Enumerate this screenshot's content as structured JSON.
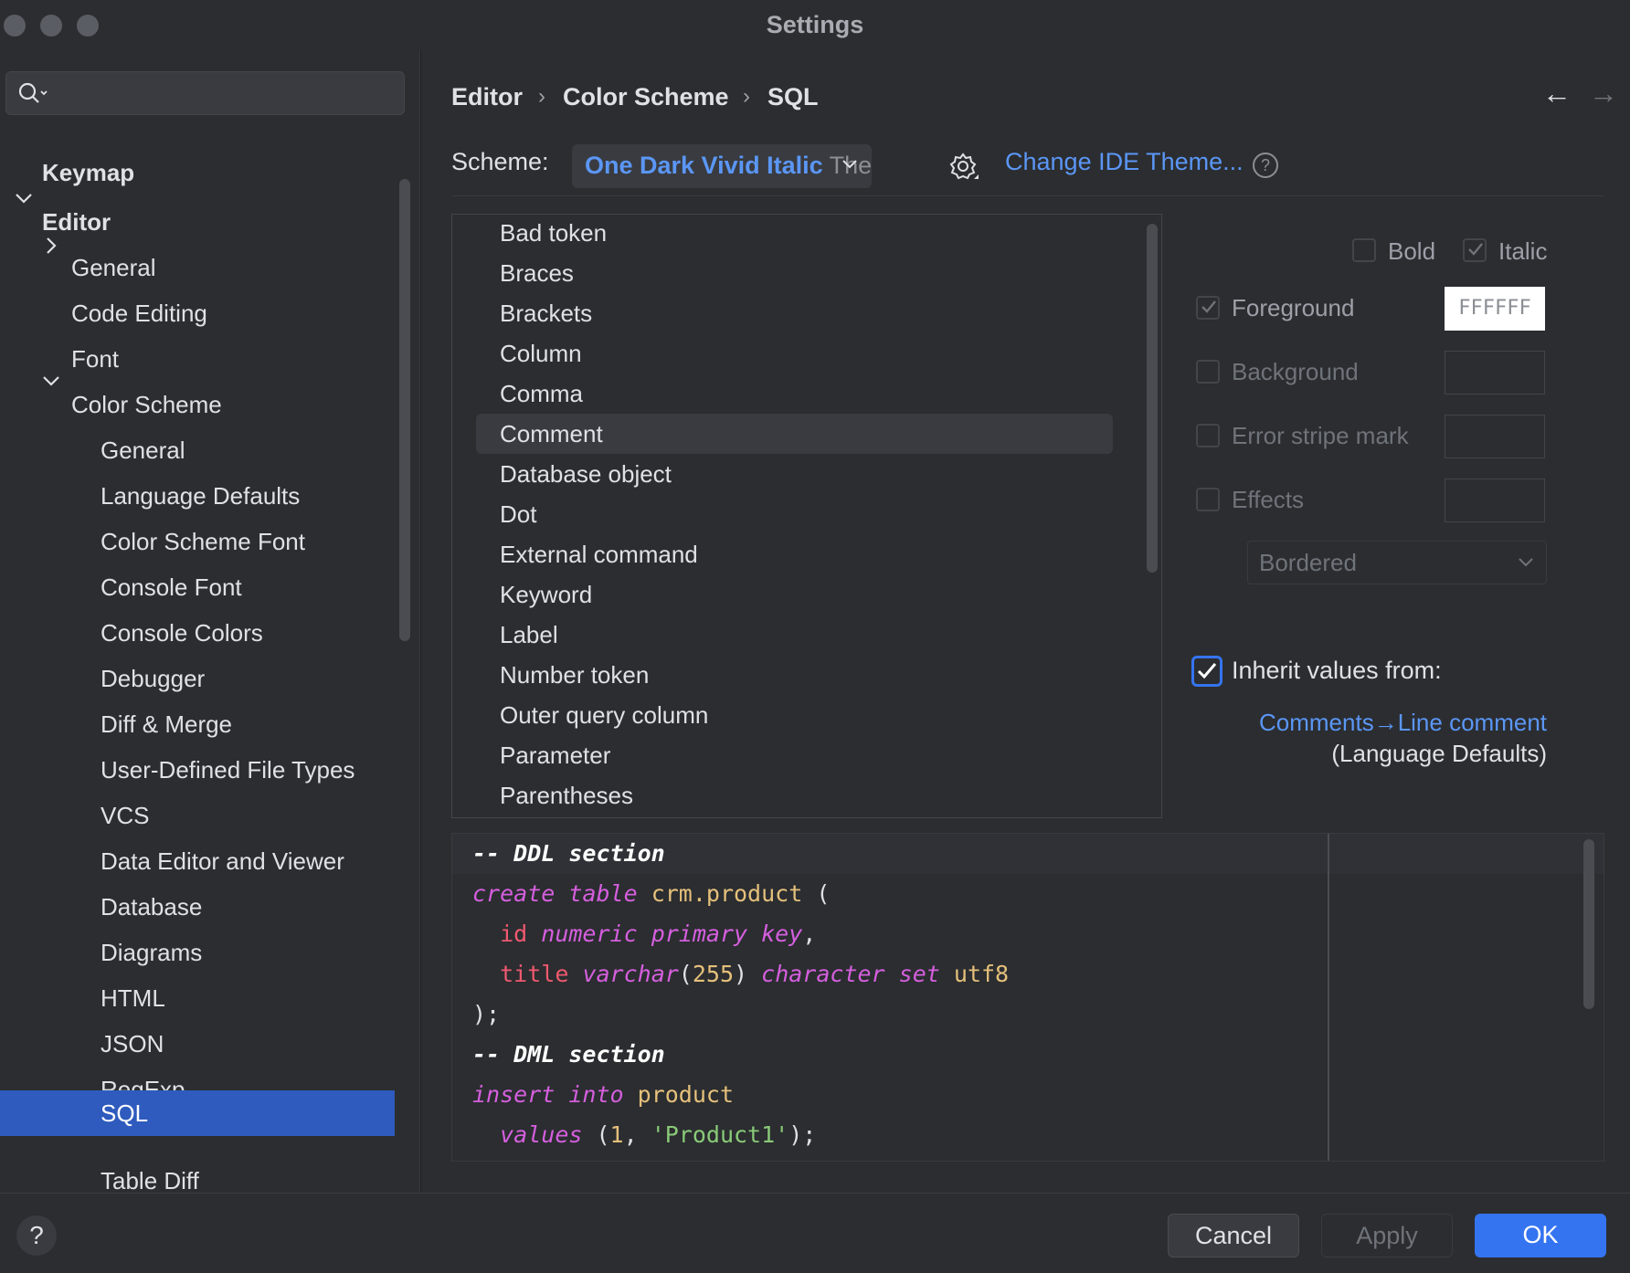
{
  "window": {
    "title": "Settings"
  },
  "sidebar": {
    "search_placeholder": "",
    "items": [
      {
        "label": "Keymap"
      },
      {
        "label": "Editor"
      },
      {
        "label": "General"
      },
      {
        "label": "Code Editing"
      },
      {
        "label": "Font"
      },
      {
        "label": "Color Scheme"
      },
      {
        "label": "General"
      },
      {
        "label": "Language Defaults"
      },
      {
        "label": "Color Scheme Font"
      },
      {
        "label": "Console Font"
      },
      {
        "label": "Console Colors"
      },
      {
        "label": "Debugger"
      },
      {
        "label": "Diff & Merge"
      },
      {
        "label": "User-Defined File Types"
      },
      {
        "label": "VCS"
      },
      {
        "label": "Data Editor and Viewer"
      },
      {
        "label": "Database"
      },
      {
        "label": "Diagrams"
      },
      {
        "label": "HTML"
      },
      {
        "label": "JSON"
      },
      {
        "label": "RegExp"
      },
      {
        "label": "SQL"
      },
      {
        "label": "Table Diff"
      }
    ],
    "selected": "SQL"
  },
  "breadcrumb": [
    "Editor",
    "Color Scheme",
    "SQL"
  ],
  "scheme": {
    "label": "Scheme:",
    "value_bold": "One Dark Vivid Italic",
    "value_suffix": " Them",
    "change_theme_link": "Change IDE Theme...",
    "help_glyph": "?"
  },
  "attributes": {
    "items": [
      "Bad token",
      "Braces",
      "Brackets",
      "Column",
      "Comma",
      "Comment",
      "Database object",
      "Dot",
      "External command",
      "Keyword",
      "Label",
      "Number token",
      "Outer query column",
      "Parameter",
      "Parentheses"
    ],
    "selected": "Comment"
  },
  "options": {
    "bold": {
      "label": "Bold",
      "checked": false
    },
    "italic": {
      "label": "Italic",
      "checked": true
    },
    "foreground": {
      "label": "Foreground",
      "checked": true,
      "value": "FFFFFF"
    },
    "background": {
      "label": "Background",
      "checked": false
    },
    "error_stripe": {
      "label": "Error stripe mark",
      "checked": false
    },
    "effects": {
      "label": "Effects",
      "checked": false,
      "type": "Bordered"
    },
    "inherit": {
      "label": "Inherit values from:",
      "checked": true,
      "link": "Comments→Line comment",
      "sub": "(Language Defaults)"
    }
  },
  "preview": {
    "line1": "-- DDL section",
    "line2_a": "create",
    "line2_b": "table",
    "line2_c": "crm.product",
    "line2_d": " (",
    "line3_a": "id",
    "line3_b": "numeric",
    "line3_c": "primary",
    "line3_d": "key",
    "line3_e": ",",
    "line4_a": "title",
    "line4_b": "varchar",
    "line4_c": "(",
    "line4_d": "255",
    "line4_e": ")",
    "line4_f": "character",
    "line4_g": "set",
    "line4_h": "utf8",
    "line5": ");",
    "line6": "-- DML section",
    "line7_a": "insert",
    "line7_b": "into",
    "line7_c": "product",
    "line8_a": "values",
    "line8_b": " (",
    "line8_c": "1",
    "line8_d": ", ",
    "line8_e": "'Product1'",
    "line8_f": ");"
  },
  "footer": {
    "help": "?",
    "cancel": "Cancel",
    "apply": "Apply",
    "ok": "OK"
  },
  "colors": {
    "accent": "#3574f0",
    "selection": "#2e5bbd",
    "link": "#5b96f5"
  }
}
